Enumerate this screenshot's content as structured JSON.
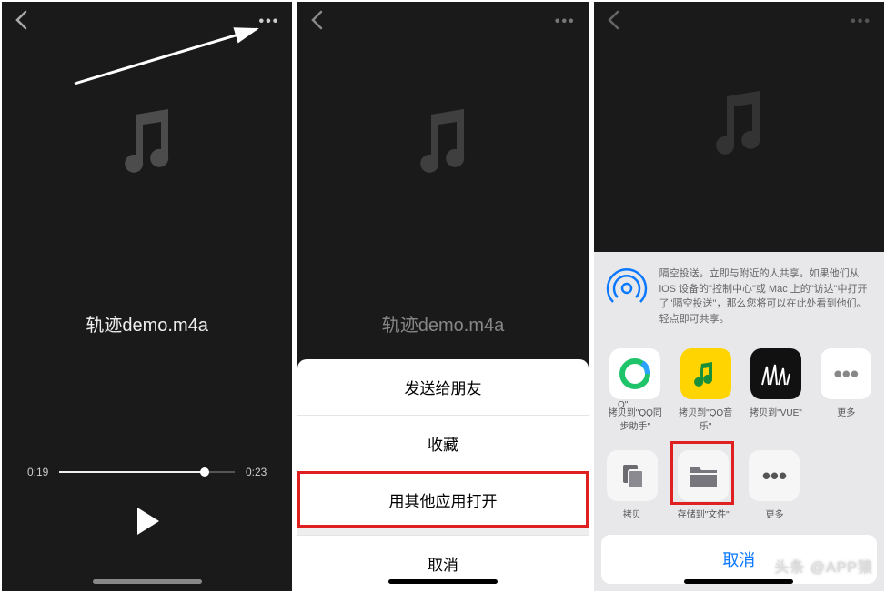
{
  "file": {
    "name": "轨迹demo.m4a"
  },
  "player": {
    "elapsed": "0:19",
    "total": "0:23"
  },
  "sheet_options": {
    "send": "发送给朋友",
    "favorite": "收藏",
    "open_with": "用其他应用打开",
    "cancel": "取消"
  },
  "share": {
    "airdrop_text": "隔空投送。立即与附近的人共享。如果他们从 iOS 设备的\"控制中心\"或 Mac 上的\"访达\"中打开了\"隔空投送\"，那么您将可以在此处看到他们。轻点即可共享。",
    "apps": [
      {
        "label": "拷贝到\"QQ同步助手\""
      },
      {
        "label": "拷贝到\"QQ音乐\""
      },
      {
        "label": "拷贝到\"VUE\""
      },
      {
        "label": "更多"
      }
    ],
    "actions": [
      {
        "label": "拷贝"
      },
      {
        "label": "存储到\"文件\""
      },
      {
        "label": "更多"
      }
    ],
    "cancel": "取消",
    "cut_app_label": "Q\""
  },
  "watermark": "头条 @APP猿"
}
